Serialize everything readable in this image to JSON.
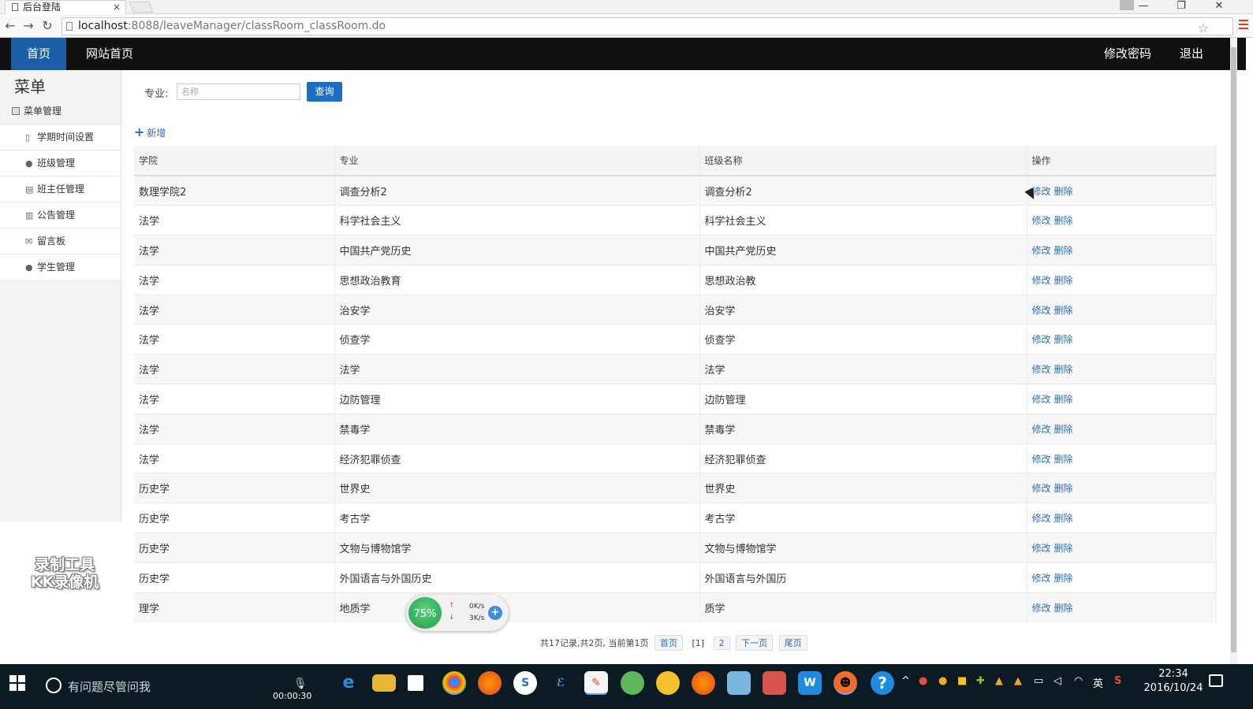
{
  "browser": {
    "tab_title": "后台登陆",
    "tab_close": "×",
    "url_host": "localhost",
    "url_rest": ":8088/leaveManager/classRoom_classRoom.do",
    "window_controls": [
      "—",
      "❐",
      "✕"
    ],
    "nav": {
      "back": "←",
      "forward": "→",
      "reload": "↻"
    },
    "star": "☆"
  },
  "topnav": {
    "home": "首页",
    "site_home": "网站首页",
    "change_password": "修改密码",
    "logout": "退出"
  },
  "sidebar": {
    "title": "菜单",
    "group": "菜单管理",
    "items": [
      {
        "label": "学期时间设置",
        "icon": "document-icon"
      },
      {
        "label": "班级管理",
        "icon": "chat-icon"
      },
      {
        "label": "班主任管理",
        "icon": "list-icon"
      },
      {
        "label": "公告管理",
        "icon": "book-icon"
      },
      {
        "label": "留言板",
        "icon": "mail-icon"
      },
      {
        "label": "学生管理",
        "icon": "chat-icon"
      }
    ]
  },
  "watermark": {
    "line1": "录制工具",
    "line2": "KK录像机"
  },
  "search": {
    "label": "专业:",
    "placeholder": "名称",
    "value": "",
    "button": "查询"
  },
  "add_link": "新增",
  "table": {
    "headers": [
      "学院",
      "专业",
      "班级名称",
      "操作"
    ],
    "edit_label": "修改",
    "delete_label": "删除",
    "rows": [
      {
        "college": "数理学院2",
        "major": "调查分析2",
        "class_name": "调查分析2"
      },
      {
        "college": "法学",
        "major": "科学社会主义",
        "class_name": "科学社会主义"
      },
      {
        "college": "法学",
        "major": "中国共产党历史",
        "class_name": "中国共产党历史"
      },
      {
        "college": "法学",
        "major": "思想政治教育",
        "class_name": "思想政治教"
      },
      {
        "college": "法学",
        "major": "治安学",
        "class_name": "治安学"
      },
      {
        "college": "法学",
        "major": "侦查学",
        "class_name": "侦查学"
      },
      {
        "college": "法学",
        "major": "法学",
        "class_name": "法学"
      },
      {
        "college": "法学",
        "major": "边防管理",
        "class_name": "边防管理"
      },
      {
        "college": "法学",
        "major": "禁毒学",
        "class_name": "禁毒学"
      },
      {
        "college": "法学",
        "major": "经济犯罪侦查",
        "class_name": "经济犯罪侦查"
      },
      {
        "college": "历史学",
        "major": "世界史",
        "class_name": "世界史"
      },
      {
        "college": "历史学",
        "major": "考古学",
        "class_name": "考古学"
      },
      {
        "college": "历史学",
        "major": "文物与博物馆学",
        "class_name": "文物与博物馆学"
      },
      {
        "college": "历史学",
        "major": "外国语言与外国历史",
        "class_name": "外国语言与外国历"
      },
      {
        "college": "理学",
        "major": "地质学",
        "class_name": "质学"
      }
    ]
  },
  "pager": {
    "summary": "共17记录,共2页, 当前第1页",
    "first": "首页",
    "current": "[1]",
    "page2": "2",
    "next": "下一页",
    "last": "尾页"
  },
  "net_widget": {
    "percent": "75%",
    "up": "0K/s",
    "down": "3K/s",
    "up_arrow": "↑",
    "down_arrow": "↓",
    "boost": "+"
  },
  "taskbar": {
    "search_placeholder": "有问题尽管问我",
    "record_time": "00:00:30",
    "tray_lang": "英",
    "time": "22:34",
    "date": "2016/10/24"
  },
  "colors": {
    "nav_bg": "#111111",
    "nav_active": "#1b5fa8",
    "link": "#2a6ebb",
    "query_button": "#1d6fc5",
    "taskbar": "#0c1a24"
  }
}
